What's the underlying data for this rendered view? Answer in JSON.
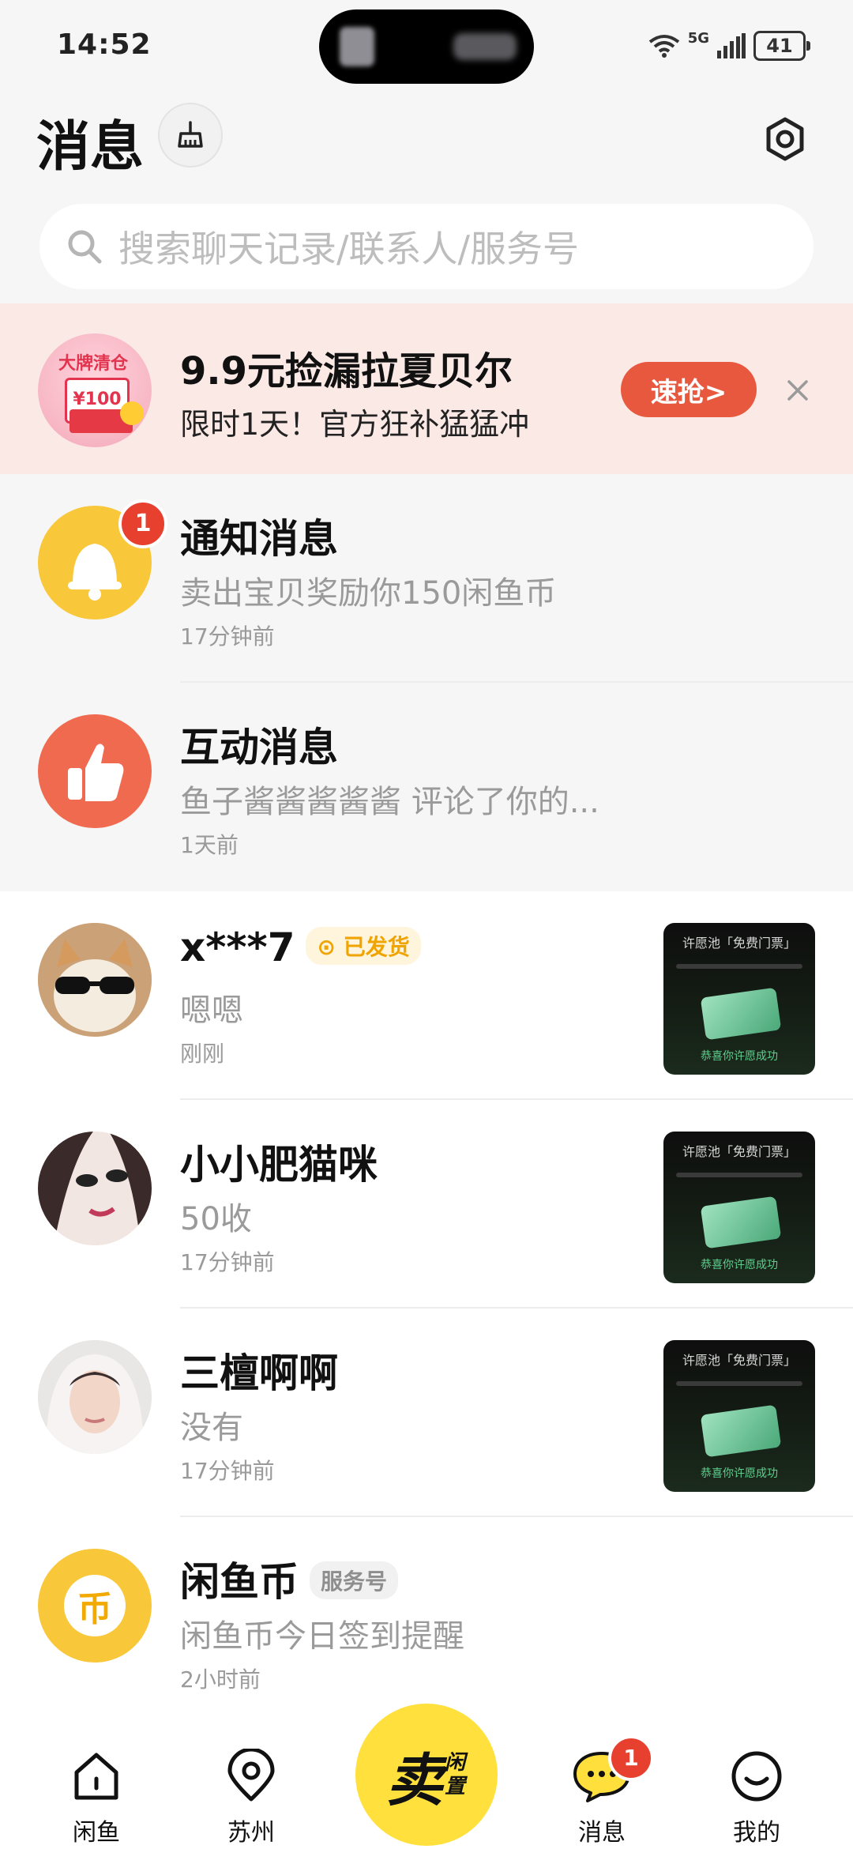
{
  "status_bar": {
    "time": "14:52",
    "network": "5G",
    "battery": "41"
  },
  "header": {
    "title": "消息"
  },
  "search": {
    "placeholder": "搜索聊天记录/联系人/服务号"
  },
  "banner": {
    "image_text": "大牌清仓",
    "image_card": "¥100",
    "title": "9.9元捡漏拉夏贝尔",
    "subtitle": "限时1天！官方狂补猛猛冲",
    "button": "速抢>"
  },
  "system_messages": [
    {
      "name": "通知消息",
      "preview": "卖出宝贝奖励你150闲鱼币",
      "time": "17分钟前",
      "badge": "1"
    },
    {
      "name": "互动消息",
      "preview": "鱼子酱酱酱酱酱 评论了你的...",
      "time": "1天前"
    }
  ],
  "chats": [
    {
      "name": "x***7",
      "tag": "已发货",
      "preview": "嗯嗯",
      "time": "刚刚"
    },
    {
      "name": "小小肥猫咪",
      "preview": "50收",
      "time": "17分钟前"
    },
    {
      "name": "三檀啊啊",
      "preview": "没有",
      "time": "17分钟前"
    },
    {
      "name": "闲鱼币",
      "tag": "服务号",
      "preview": "闲鱼币今日签到提醒",
      "time": "2小时前",
      "avatar_glyph": "币"
    }
  ],
  "thumbnail": {
    "title": "许愿池「免费门票」",
    "footer": "恭喜你许愿成功"
  },
  "tabbar": {
    "home": "闲鱼",
    "city": "苏州",
    "sell_big": "卖",
    "sell_small": "闲置",
    "messages": "消息",
    "messages_badge": "1",
    "mine": "我的"
  },
  "colors": {
    "accent_yellow": "#ffe03c",
    "badge_red": "#e8402f",
    "banner_bg": "#fbe9e5",
    "grab_button": "#e8583e"
  }
}
